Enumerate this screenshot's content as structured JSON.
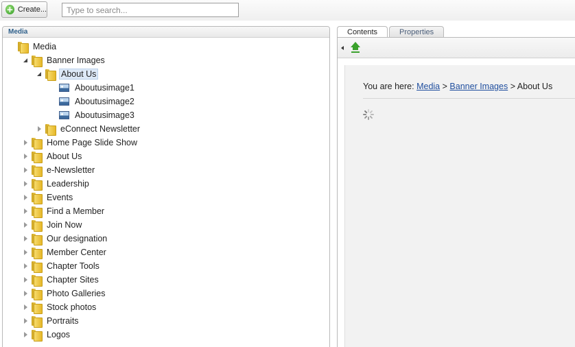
{
  "toolbar": {
    "create_label": "Create...",
    "search_placeholder": "Type to search..."
  },
  "media_panel": {
    "header": "Media",
    "tree": [
      {
        "label": "Media",
        "depth": 0,
        "expander": "none",
        "icon": "folder-icon"
      },
      {
        "label": "Banner Images",
        "depth": 1,
        "expander": "open",
        "icon": "folder-icon"
      },
      {
        "label": "About Us",
        "depth": 2,
        "expander": "open",
        "icon": "folder-icon",
        "selected": true
      },
      {
        "label": "Aboutusimage1",
        "depth": 3,
        "expander": "none",
        "icon": "image-icon"
      },
      {
        "label": "Aboutusimage2",
        "depth": 3,
        "expander": "none",
        "icon": "image-icon"
      },
      {
        "label": "Aboutusimage3",
        "depth": 3,
        "expander": "none",
        "icon": "image-icon"
      },
      {
        "label": "eConnect Newsletter",
        "depth": 2,
        "expander": "closed",
        "icon": "folder-icon"
      },
      {
        "label": "Home Page Slide Show",
        "depth": 1,
        "expander": "closed",
        "icon": "folder-icon"
      },
      {
        "label": "About Us",
        "depth": 1,
        "expander": "closed",
        "icon": "folder-icon"
      },
      {
        "label": "e-Newsletter",
        "depth": 1,
        "expander": "closed",
        "icon": "folder-icon"
      },
      {
        "label": "Leadership",
        "depth": 1,
        "expander": "closed",
        "icon": "folder-icon"
      },
      {
        "label": "Events",
        "depth": 1,
        "expander": "closed",
        "icon": "folder-icon"
      },
      {
        "label": "Find a Member",
        "depth": 1,
        "expander": "closed",
        "icon": "folder-icon"
      },
      {
        "label": "Join Now",
        "depth": 1,
        "expander": "closed",
        "icon": "folder-icon"
      },
      {
        "label": "Our designation",
        "depth": 1,
        "expander": "closed",
        "icon": "folder-icon"
      },
      {
        "label": "Member Center",
        "depth": 1,
        "expander": "closed",
        "icon": "folder-icon"
      },
      {
        "label": "Chapter Tools",
        "depth": 1,
        "expander": "closed",
        "icon": "folder-icon"
      },
      {
        "label": "Chapter Sites",
        "depth": 1,
        "expander": "closed",
        "icon": "folder-icon"
      },
      {
        "label": "Photo Galleries",
        "depth": 1,
        "expander": "closed",
        "icon": "folder-icon"
      },
      {
        "label": "Stock photos",
        "depth": 1,
        "expander": "closed",
        "icon": "folder-icon"
      },
      {
        "label": "Portraits",
        "depth": 1,
        "expander": "closed",
        "icon": "folder-icon"
      },
      {
        "label": "Logos",
        "depth": 1,
        "expander": "closed",
        "icon": "folder-icon"
      }
    ]
  },
  "detail_panel": {
    "tabs": [
      {
        "label": "Contents",
        "active": true
      },
      {
        "label": "Properties",
        "active": false
      }
    ],
    "breadcrumb": {
      "prefix": "You are here:",
      "separator": ">",
      "links": [
        "Media",
        "Banner Images"
      ],
      "current": "About Us"
    }
  }
}
